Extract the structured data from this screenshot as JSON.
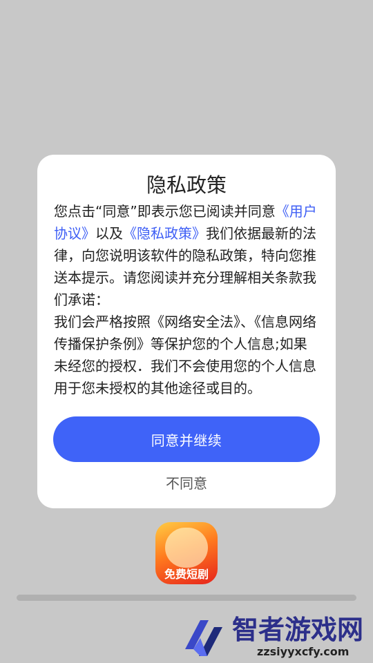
{
  "dialog": {
    "title": "隐私政策",
    "body": {
      "p1_part1": "您点击“同意”即表示您已阅读并同意",
      "link_user_agreement": "《用户协议》",
      "p1_part2": "以及",
      "link_privacy_policy": "《隐私政策》",
      "p1_part3": "我们依据最新的法律，向您说明该软件的隐私政策，特向您推送本提示。请您阅读并充分理解相关条款我们承诺：",
      "p2": "我们会严格按照《网络安全法》、《信息网络传播保护条例》等保护您的个人信息;如果未经您的授权．我们不会使用您的个人信息用于您未授权的其他途径或目的。"
    },
    "agree_label": "同意并继续",
    "disagree_label": "不同意"
  },
  "app_icon": {
    "label": "免费短剧"
  },
  "watermark": {
    "text": "智者游戏网",
    "url": "zzsiyyxcfy.com"
  },
  "colors": {
    "accent": "#3f63f8",
    "link": "#3d5ef5",
    "background": "#c8c8c8"
  }
}
